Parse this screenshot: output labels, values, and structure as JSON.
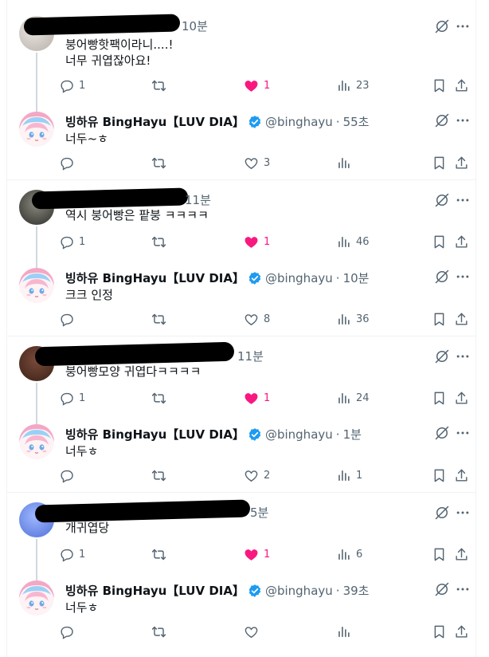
{
  "threads": [
    {
      "reply": {
        "time": "10분",
        "lines": "붕어빵핫팩이라니....!\n너무 귀엽잖아요!",
        "replies": "1",
        "likes": "1",
        "views": "23"
      },
      "response": {
        "name": "빙하유 BingHayu【LUV DIA】",
        "handle": "@binghayu",
        "time": "55초",
        "text": "너두~ㅎ",
        "likes": "3"
      }
    },
    {
      "reply": {
        "time": "11분",
        "lines": "역시 붕어빵은 팥붕 ㅋㅋㅋㅋ",
        "replies": "1",
        "likes": "1",
        "views": "46"
      },
      "response": {
        "name": "빙하유 BingHayu【LUV DIA】",
        "handle": "@binghayu",
        "time": "10분",
        "text": "크크 인정",
        "likes": "8",
        "views": "36"
      }
    },
    {
      "reply": {
        "time": "11분",
        "lines": "붕어빵모양 귀엽다ㅋㅋㅋㅋ",
        "replies": "1",
        "likes": "1",
        "views": "24"
      },
      "response": {
        "name": "빙하유 BingHayu【LUV DIA】",
        "handle": "@binghayu",
        "time": "1분",
        "text": "너두ㅎ",
        "likes": "2",
        "views": "1"
      }
    },
    {
      "reply": {
        "time": "5분",
        "lines": "개귀엽당",
        "replies": "1",
        "likes": "1",
        "views": "6"
      },
      "response": {
        "name": "빙하유 BingHayu【LUV DIA】",
        "handle": "@binghayu",
        "time": "39초",
        "text": "너두ㅎ"
      }
    }
  ],
  "separator": "·",
  "colors": {
    "like": "#f91880",
    "verified": "#1d9bf0",
    "muted": "#536471"
  }
}
